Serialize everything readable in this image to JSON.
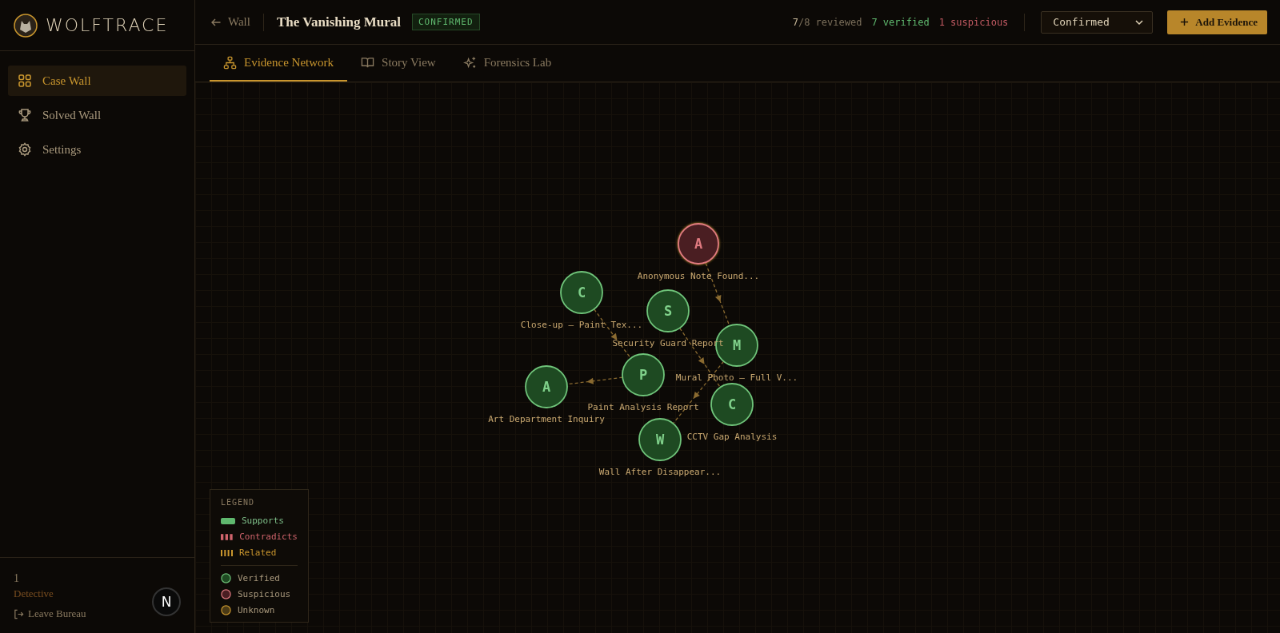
{
  "sidebar": {
    "logo": "WOLFTRACE",
    "items": [
      {
        "label": "Case Wall",
        "selected": true
      },
      {
        "label": "Solved Wall",
        "selected": false
      },
      {
        "label": "Settings",
        "selected": false
      }
    ],
    "footer": {
      "count": "1",
      "role": "Detective",
      "logout": "Leave Bureau"
    }
  },
  "dev_badge": "N",
  "header": {
    "back": "Wall",
    "title": "The Vanishing Mural",
    "status_badge": "CONFIRMED",
    "stats": {
      "reviewed_count": "7",
      "reviewed_rest": "/8 reviewed",
      "verified": "7 verified",
      "suspicious": "1 suspicious"
    },
    "status_select": "Confirmed",
    "add_button": "Add Evidence"
  },
  "tabs": [
    {
      "label": "Evidence Network",
      "selected": true
    },
    {
      "label": "Story View",
      "selected": false
    },
    {
      "label": "Forensics Lab",
      "selected": false
    }
  ],
  "nodes": [
    {
      "letter": "A",
      "label": "Anonymous Note Found...",
      "kind": "suspicious"
    },
    {
      "letter": "C",
      "label": "Close-up – Paint Tex...",
      "kind": "verified"
    },
    {
      "letter": "S",
      "label": "Security Guard Report",
      "kind": "verified"
    },
    {
      "letter": "M",
      "label": "Mural Photo – Full V...",
      "kind": "verified"
    },
    {
      "letter": "P",
      "label": "Paint Analysis Report",
      "kind": "verified"
    },
    {
      "letter": "A",
      "label": "Art Department Inquiry",
      "kind": "verified"
    },
    {
      "letter": "C",
      "label": "CCTV Gap Analysis",
      "kind": "verified"
    },
    {
      "letter": "W",
      "label": "Wall After Disappear...",
      "kind": "verified"
    }
  ],
  "legend": {
    "title": "LEGEND",
    "links": [
      {
        "label": "Supports",
        "kind": "supports"
      },
      {
        "label": "Contradicts",
        "kind": "contradicts"
      },
      {
        "label": "Related",
        "kind": "related"
      }
    ],
    "statuses": [
      {
        "label": "Verified",
        "kind": "verified"
      },
      {
        "label": "Suspicious",
        "kind": "suspicious"
      },
      {
        "label": "Unknown",
        "kind": "unknown"
      }
    ]
  }
}
